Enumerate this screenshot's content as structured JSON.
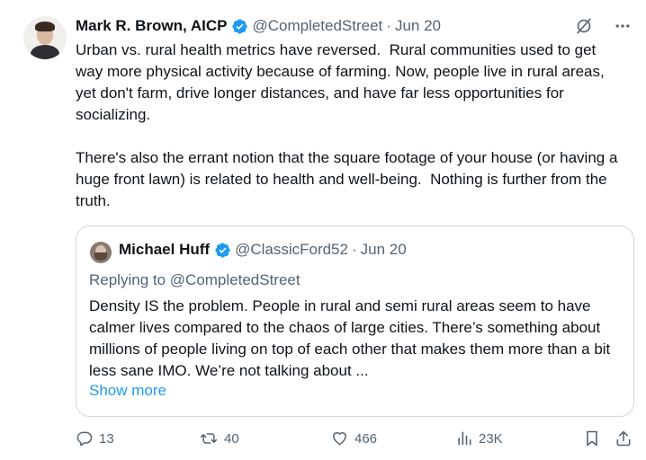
{
  "author": {
    "name": "Mark R. Brown, AICP",
    "handle": "@CompletedStreet",
    "separator": "·",
    "date": "Jun 20"
  },
  "tweet_text": "Urban vs. rural health metrics have reversed.  Rural communities used to get way more physical activity because of farming. Now, people live in rural areas, yet don't farm, drive longer distances, and have far less opportunities for socializing.\n\nThere's also the errant notion that the square footage of your house (or having a huge front lawn) is related to health and well-being.  Nothing is further from the truth.",
  "quoted": {
    "name": "Michael Huff",
    "handle": "@ClassicFord52",
    "separator": "·",
    "date": "Jun 20",
    "replying_prefix": "Replying to ",
    "replying_to": "@CompletedStreet",
    "text": "Density IS the problem. People in rural and semi rural areas seem to have calmer lives compared to the chaos of large cities. There’s something about millions of people living on top of each other that makes them more than a bit less sane IMO. We’re not talking about ...",
    "show_more": "Show more"
  },
  "actions": {
    "replies": "13",
    "reposts": "40",
    "likes": "466",
    "views": "23K"
  },
  "icons": {
    "verified": "verified-badge-icon",
    "grok": "grok-icon",
    "more": "more-icon",
    "reply": "reply-icon",
    "repost": "repost-icon",
    "like": "heart-icon",
    "views": "views-icon",
    "bookmark": "bookmark-icon",
    "share": "share-icon"
  },
  "colors": {
    "verified": "#1d9bf0",
    "link": "#1d9bf0",
    "muted": "#536471",
    "text": "#0f1419",
    "border": "#cfd9de"
  }
}
